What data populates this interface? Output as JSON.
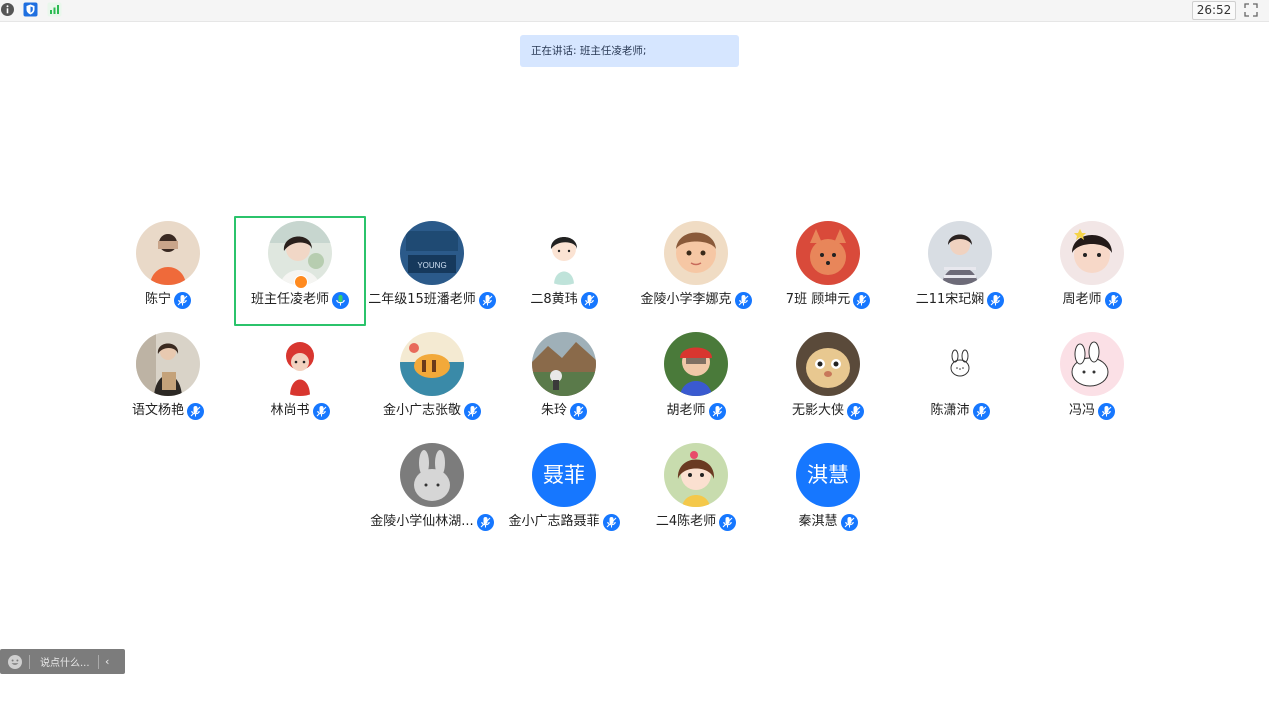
{
  "topbar": {
    "timer": "26:52",
    "icons": [
      "info-icon",
      "shield-icon",
      "signal-icon",
      "fullscreen-icon"
    ]
  },
  "speaking": {
    "text": "正在讲话: 班主任凌老师;"
  },
  "participants": [
    {
      "name": "陈宁",
      "avatar": "photo-orange"
    },
    {
      "name": "班主任凌老师",
      "avatar": "photo-girl",
      "active": true,
      "host": true
    },
    {
      "name": "二年级15班潘老师",
      "avatar": "photo-book"
    },
    {
      "name": "二8黄玮",
      "avatar": "cartoon-girl"
    },
    {
      "name": "金陵小学李娜克",
      "avatar": "photo-baby"
    },
    {
      "name": "7班 顾坤元",
      "avatar": "cartoon-fox"
    },
    {
      "name": "二11宋玘娴",
      "avatar": "photo-girl-2"
    },
    {
      "name": "周老师",
      "avatar": "photo-child"
    },
    {
      "name": "语文杨艳",
      "avatar": "photo-woman"
    },
    {
      "name": "林尚书",
      "avatar": "cartoon-red"
    },
    {
      "name": "金小广志张敬",
      "avatar": "cartoon-cat"
    },
    {
      "name": "朱玲",
      "avatar": "photo-landscape"
    },
    {
      "name": "胡老师",
      "avatar": "photo-kid"
    },
    {
      "name": "无影大侠",
      "avatar": "photo-cat"
    },
    {
      "name": "陈潇沛",
      "avatar": "sketch-bunny"
    },
    {
      "name": "冯冯",
      "avatar": "cartoon-bunny"
    },
    {
      "name": "金陵小学仙林湖...",
      "avatar": "gray-bunny"
    },
    {
      "name": "金小广志路聂菲",
      "avatar_text": "聂菲"
    },
    {
      "name": "二4陈老师",
      "avatar": "cartoon-girl-2"
    },
    {
      "name": "秦淇慧",
      "avatar_text": "淇慧"
    }
  ],
  "chat": {
    "placeholder": "说点什么...",
    "icons": [
      "emoji-icon",
      "collapse-icon"
    ]
  },
  "colors": {
    "accent": "#1677ff",
    "active_border": "#2bc36b",
    "banner_bg": "#d6e6ff"
  }
}
